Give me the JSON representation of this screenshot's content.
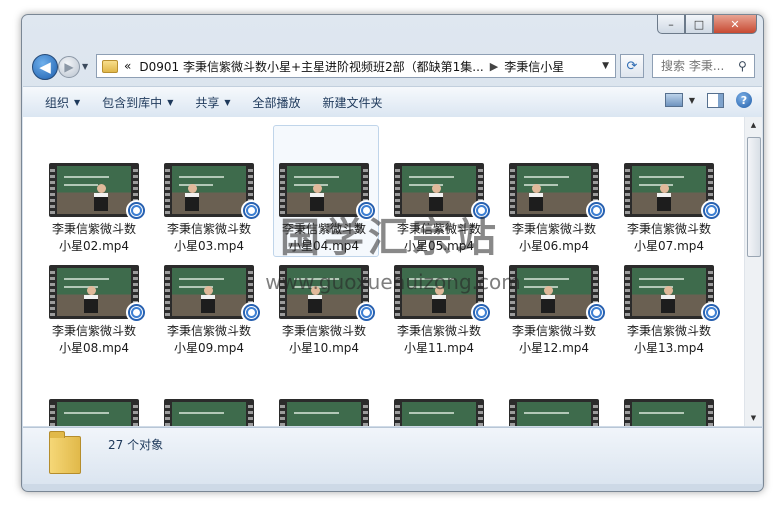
{
  "window": {
    "buttons": {
      "minimize": "–",
      "maximize": "□",
      "close": "✕"
    }
  },
  "nav": {
    "back_icon": "back-arrow-icon",
    "forward_icon": "forward-arrow-icon",
    "address_prefix": "«",
    "breadcrumb_parent": "D0901 李秉信紫微斗数小星+主星进阶视频班2部（都缺第1集...",
    "breadcrumb_current": "李秉信小星",
    "search_placeholder": "搜索 李秉..."
  },
  "toolbar": {
    "organize": "组织",
    "include_library": "包含到库中",
    "share": "共享",
    "play_all": "全部播放",
    "new_folder": "新建文件夹"
  },
  "files": [
    {
      "name": "李秉信紫微斗数小星02.mp4",
      "selected": false
    },
    {
      "name": "李秉信紫微斗数小星03.mp4",
      "selected": false
    },
    {
      "name": "李秉信紫微斗数小星04.mp4",
      "selected": true
    },
    {
      "name": "李秉信紫微斗数小星05.mp4",
      "selected": false
    },
    {
      "name": "李秉信紫微斗数小星06.mp4",
      "selected": false
    },
    {
      "name": "李秉信紫微斗数小星07.mp4",
      "selected": false
    },
    {
      "name": "李秉信紫微斗数小星08.mp4",
      "selected": false
    },
    {
      "name": "李秉信紫微斗数小星09.mp4",
      "selected": false
    },
    {
      "name": "李秉信紫微斗数小星10.mp4",
      "selected": false
    },
    {
      "name": "李秉信紫微斗数小星11.mp4",
      "selected": false
    },
    {
      "name": "李秉信紫微斗数小星12.mp4",
      "selected": false
    },
    {
      "name": "李秉信紫微斗数小星13.mp4",
      "selected": false
    }
  ],
  "status": {
    "count": "27 个对象"
  },
  "watermark": {
    "text": "国学汇宗站",
    "url": "www.guoxuehuizong.com"
  }
}
